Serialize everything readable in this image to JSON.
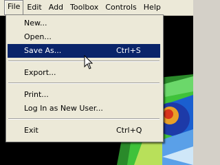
{
  "menubar": {
    "items": [
      "File",
      "Edit",
      "Add",
      "Toolbox",
      "Controls",
      "Help"
    ]
  },
  "file_menu": {
    "new": "New...",
    "open": "Open...",
    "save_as": "Save As...",
    "save_as_shortcut": "Ctrl+S",
    "export": "Export...",
    "print": "Print...",
    "login": "Log In as New User...",
    "exit": "Exit",
    "exit_shortcut": "Ctrl+Q",
    "highlighted_item": "save_as"
  },
  "colors": {
    "menu_bg": "#ece9d8",
    "highlight": "#0a246a",
    "workspace": "#000000"
  }
}
